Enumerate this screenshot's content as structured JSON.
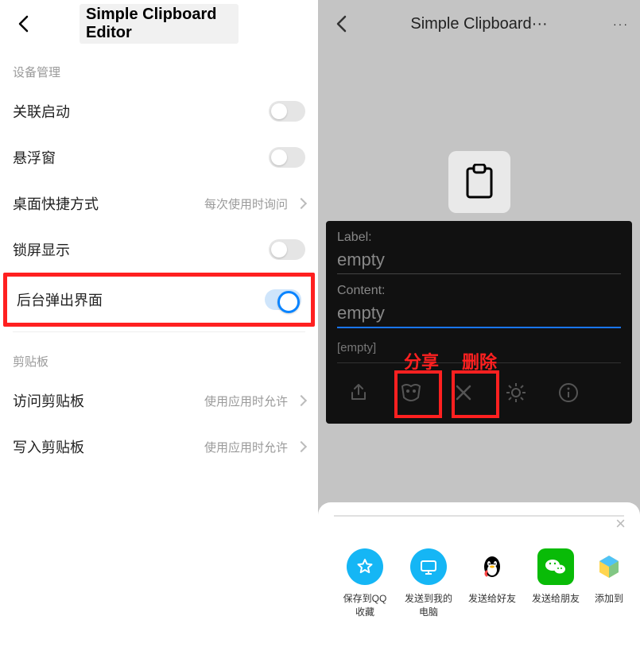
{
  "left": {
    "title": "Simple Clipboard Editor",
    "section1_label": "设备管理",
    "rows1": {
      "r0": {
        "label": "关联启动"
      },
      "r1": {
        "label": "悬浮窗"
      },
      "r2": {
        "label": "桌面快捷方式",
        "detail": "每次使用时询问"
      },
      "r3": {
        "label": "锁屏显示"
      },
      "r4": {
        "label": "后台弹出界面"
      }
    },
    "section2_label": "剪贴板",
    "rows2": {
      "r0": {
        "label": "访问剪贴板",
        "detail": "使用应用时允许"
      },
      "r1": {
        "label": "写入剪贴板",
        "detail": "使用应用时允许"
      }
    }
  },
  "right": {
    "title": "Simple Clipboard···",
    "more": "···",
    "panel": {
      "label_label": "Label:",
      "label_value": "empty",
      "content_label": "Content:",
      "content_value": "empty",
      "status": "[empty]"
    },
    "annotations": {
      "share": "分享",
      "delete": "删除"
    },
    "sheet": {
      "items": {
        "i0": {
          "label": "保存到QQ收藏",
          "color": "#15b6f5"
        },
        "i1": {
          "label": "发送到我的电脑",
          "color": "#15b6f5"
        },
        "i2": {
          "label": "发送给好友",
          "color": "#000000"
        },
        "i3": {
          "label": "发送给朋友",
          "color": "#09bb07"
        },
        "i4": {
          "label": "添加到",
          "color": "#ffc107"
        }
      }
    }
  }
}
